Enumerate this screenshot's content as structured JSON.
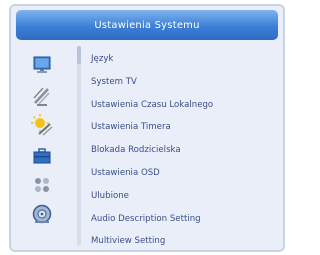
{
  "window": {
    "title": "Ustawienia Systemu"
  },
  "menu": {
    "items": [
      "Język",
      "System TV",
      "Ustawienia Czasu Lokalnego",
      "Ustawienia  Timera",
      "Blokada Rodzicielska",
      "Ustawienia OSD",
      "Ulubione",
      "Audio Description Setting",
      "Multiview Setting"
    ]
  },
  "sidebar_icons": [
    "monitor-icon",
    "satellite-dish-icon",
    "sun-satellite-icon",
    "toolbox-icon",
    "settings-dots-icon",
    "cd-player-icon"
  ],
  "colors": {
    "title_bar": "#3c7fd6",
    "panel": "#e9eef8",
    "menu_text": "#3a4f86"
  }
}
